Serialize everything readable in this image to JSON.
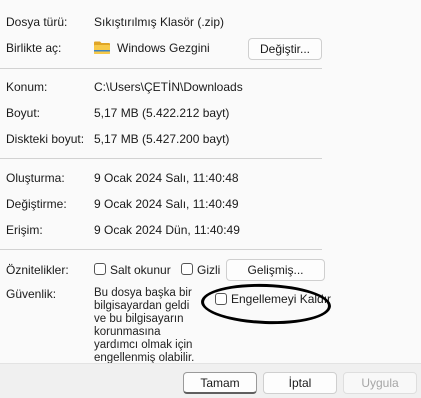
{
  "general": {
    "file_type_label": "Dosya türü:",
    "file_type_value": "Sıkıştırılmış Klasör (.zip)",
    "opens_with_label": "Birlikte aç:",
    "opens_with_value": "Windows Gezgini",
    "change_button": "Değiştir...",
    "folder_icon": "folder-icon"
  },
  "location": {
    "location_label": "Konum:",
    "location_value": "C:\\Users\\ÇETİN\\Downloads",
    "size_label": "Boyut:",
    "size_value": "5,17 MB (5.422.212 bayt)",
    "size_on_disk_label": "Diskteki boyut:",
    "size_on_disk_value": "5,17 MB (5.427.200 bayt)"
  },
  "dates": {
    "created_label": "Oluşturma:",
    "created_value": "9 Ocak 2024 Salı, 11:40:48",
    "modified_label": "Değiştirme:",
    "modified_value": "9 Ocak 2024 Salı, 11:40:49",
    "accessed_label": "Erişim:",
    "accessed_value": "9 Ocak 2024 Dün, 11:40:49"
  },
  "attributes": {
    "label": "Öznitelikler:",
    "readonly_label": "Salt okunur",
    "hidden_label": "Gizli",
    "advanced_button": "Gelişmiş..."
  },
  "security": {
    "label": "Güvenlik:",
    "text": "Bu dosya başka bir bilgisayardan geldi ve bu bilgisayarın korunmasına yardımcı olmak için engellenmiş olabilir.",
    "unblock_label": "Engellemeyi Kaldır"
  },
  "buttons": {
    "ok": "Tamam",
    "cancel": "İptal",
    "apply": "Uygula"
  },
  "colors": {
    "panel_bg": "#fafafa",
    "footer_bg": "#f0f0f0",
    "folder_yellow": "#f7c948"
  }
}
